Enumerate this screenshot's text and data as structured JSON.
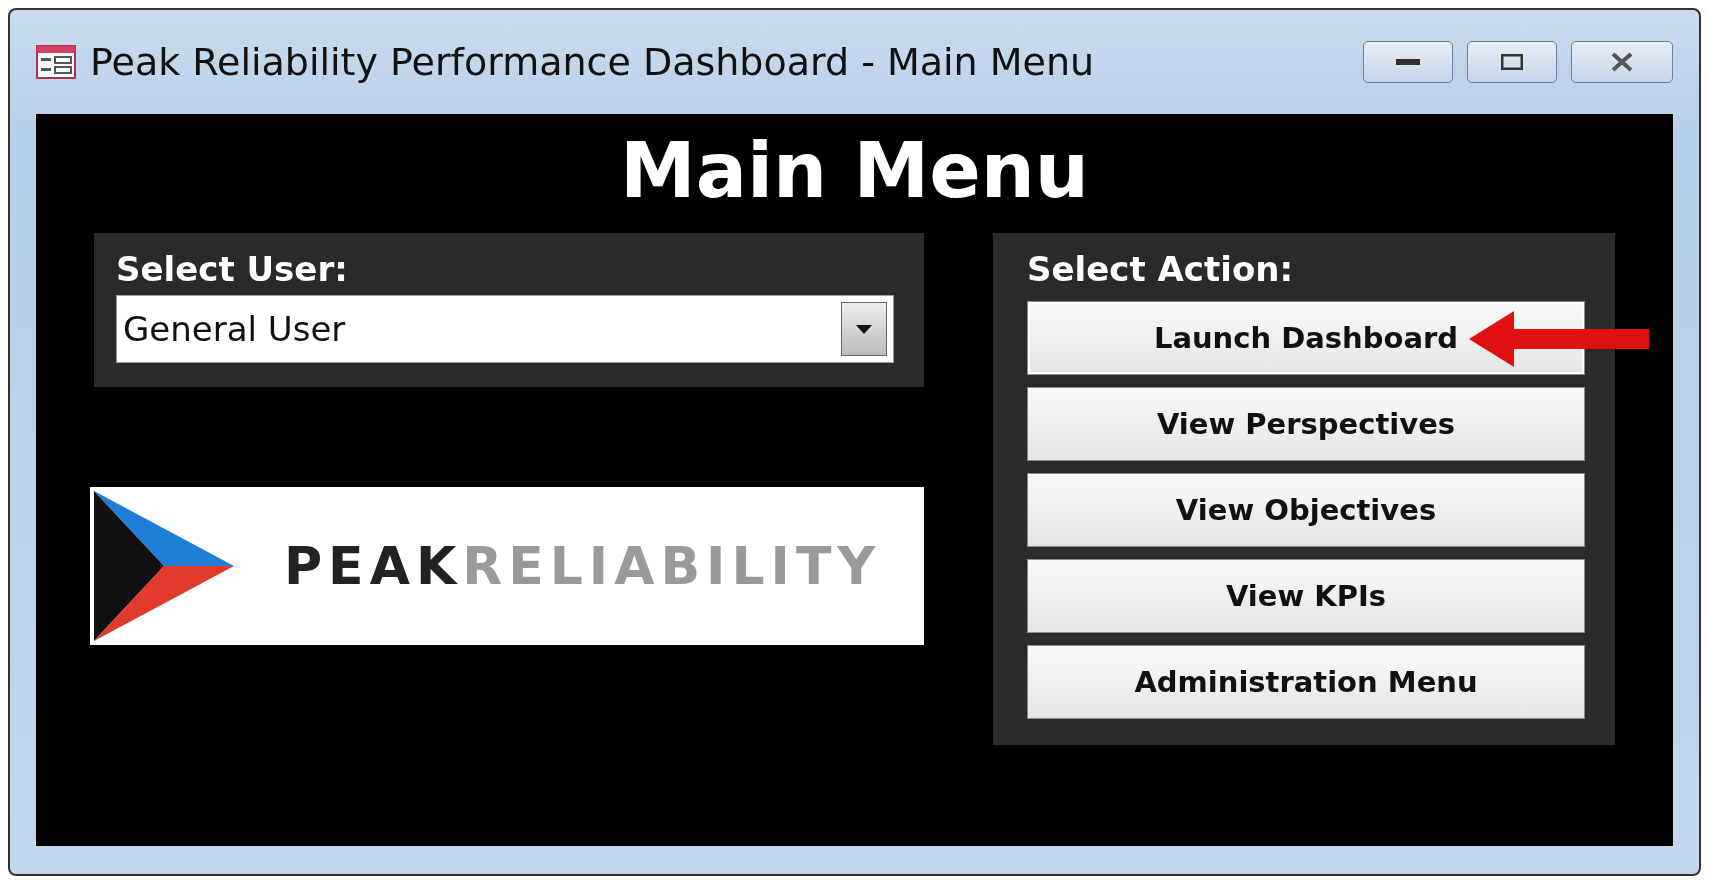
{
  "window": {
    "title": "Peak Reliability Performance Dashboard - Main Menu"
  },
  "heading": "Main Menu",
  "user_panel": {
    "label": "Select User:",
    "dropdown": {
      "value": "General User"
    }
  },
  "logo": {
    "word_dark": "PEAK",
    "word_light": "RELIABILITY"
  },
  "action_panel": {
    "label": "Select Action:",
    "buttons": [
      {
        "label": "Launch Dashboard",
        "highlighted": true
      },
      {
        "label": "View Perspectives",
        "highlighted": false
      },
      {
        "label": "View Objectives",
        "highlighted": false
      },
      {
        "label": "View KPIs",
        "highlighted": false
      },
      {
        "label": "Administration Menu",
        "highlighted": false
      }
    ]
  }
}
